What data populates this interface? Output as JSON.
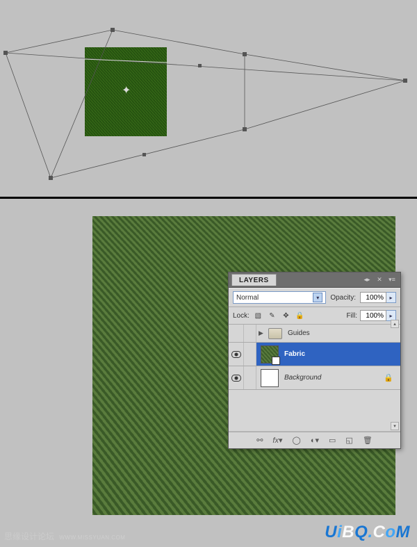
{
  "panel": {
    "title": "LAYERS",
    "blend_mode": "Normal",
    "opacity_label": "Opacity:",
    "opacity_value": "100%",
    "lock_label": "Lock:",
    "fill_label": "Fill:",
    "fill_value": "100%"
  },
  "layers": {
    "guides": {
      "name": "Guides"
    },
    "fabric": {
      "name": "Fabric"
    },
    "background": {
      "name": "Background"
    }
  },
  "watermarks": {
    "left_main": "思缘设计论坛",
    "left_sub": "WWW.MISSYUAN.COM",
    "right": {
      "p1": "U",
      "p2": "i",
      "p3": "B",
      "p4": "Q",
      "p5": ".",
      "p6": "C",
      "p7": "o",
      "p8": "M"
    }
  }
}
